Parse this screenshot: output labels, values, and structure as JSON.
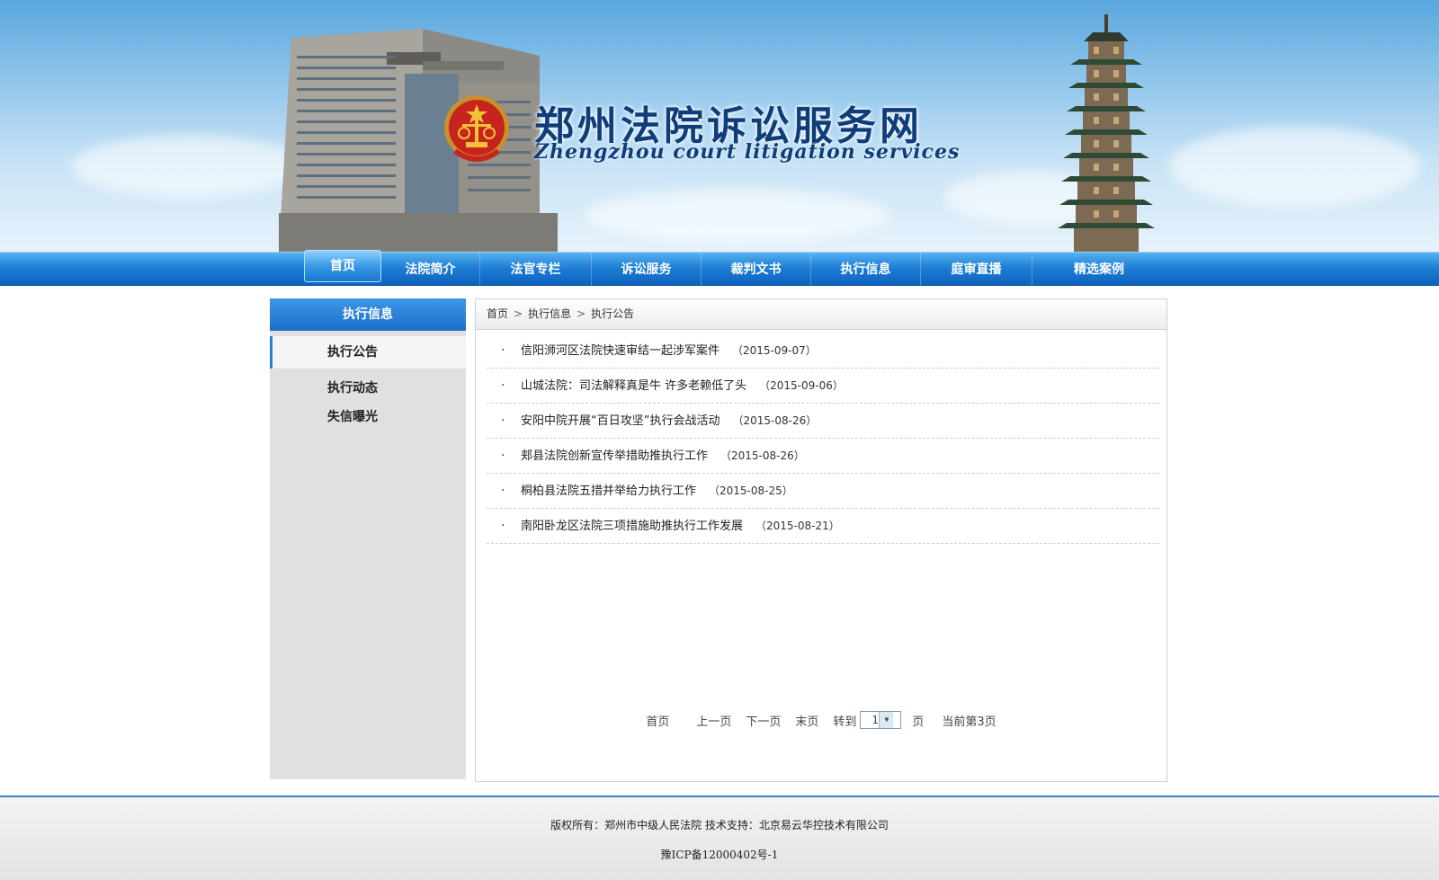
{
  "header": {
    "site_title": "郑州法院诉讼服务网",
    "site_subtitle": "Zhengzhou court litigation services"
  },
  "nav": {
    "items": [
      {
        "label": "首页",
        "active": true
      },
      {
        "label": "法院简介"
      },
      {
        "label": "法官专栏"
      },
      {
        "label": "诉讼服务"
      },
      {
        "label": "裁判文书"
      },
      {
        "label": "执行信息"
      },
      {
        "label": "庭审直播"
      },
      {
        "label": "精选案例"
      }
    ]
  },
  "sidebar": {
    "title": "执行信息",
    "items": [
      {
        "label": "执行公告",
        "active": true
      },
      {
        "label": "执行动态"
      },
      {
        "label": "失信曝光"
      }
    ]
  },
  "breadcrumb": {
    "items": [
      "首页",
      "执行信息",
      "执行公告"
    ],
    "separator": ">"
  },
  "news": {
    "bullet": "·",
    "rows": [
      {
        "title": "信阳浉河区法院快速审结一起涉军案件",
        "date": "（2015-09-07）"
      },
      {
        "title": "山城法院：司法解释真是牛 许多老赖低了头",
        "date": "（2015-09-06）"
      },
      {
        "title": "安阳中院开展“百日攻坚”执行会战活动",
        "date": "（2015-08-26）"
      },
      {
        "title": "郏县法院创新宣传举措助推执行工作",
        "date": "（2015-08-26）"
      },
      {
        "title": "桐柏县法院五措并举给力执行工作",
        "date": "（2015-08-25）"
      },
      {
        "title": "南阳卧龙区法院三项措施助推执行工作发展",
        "date": "（2015-08-21）"
      }
    ]
  },
  "pager": {
    "first": "首页",
    "prev": "上一页",
    "next": "下一页",
    "last": "末页",
    "goto_label": "转到",
    "goto_value": "1",
    "page_unit": "页",
    "current": "当前第3页"
  },
  "footer": {
    "line1": "版权所有：郑州市中级人民法院  技术支持：北京易云华控技术有限公司",
    "line2": "豫ICP备12000402号-1"
  },
  "colors": {
    "nav_blue": "#1f7fd6",
    "title_blue": "#0e3d7a",
    "sidebar_grey": "#e0e0e0",
    "accent_border": "#2b7dd1"
  }
}
